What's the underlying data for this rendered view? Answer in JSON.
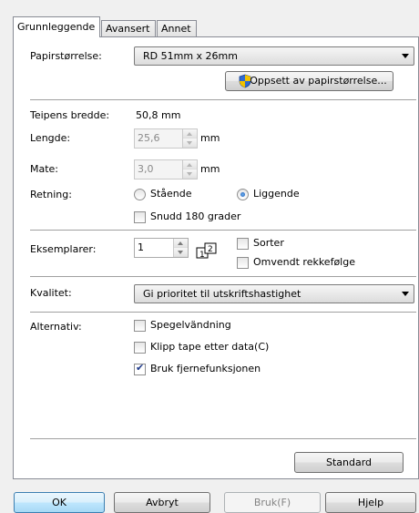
{
  "tabs": [
    "Grunnleggende",
    "Avansert",
    "Annet"
  ],
  "paper_size": {
    "label": "Papirstørrelse:",
    "value": "RD 51mm x 26mm",
    "setup_button": "Oppsett av papirstørrelse..."
  },
  "tape_width": {
    "label": "Teipens bredde:",
    "value": "50,8 mm"
  },
  "length": {
    "label": "Lengde:",
    "value": "25,6",
    "unit": "mm"
  },
  "feed": {
    "label": "Mate:",
    "value": "3,0",
    "unit": "mm"
  },
  "orientation": {
    "label": "Retning:",
    "options": [
      "Stående",
      "Liggende"
    ],
    "selected": "Liggende",
    "rotate_label": "Snudd 180 grader",
    "rotate_checked": false
  },
  "copies": {
    "label": "Eksemplarer:",
    "value": "1",
    "collate_label": "Sorter",
    "collate_checked": false,
    "reverse_label": "Omvendt rekkefølge",
    "reverse_checked": false
  },
  "quality": {
    "label": "Kvalitet:",
    "value": "Gi prioritet til utskriftshastighet"
  },
  "options": {
    "label": "Alternativ:",
    "items": [
      {
        "label": "Spegelvändning",
        "checked": false
      },
      {
        "label": "Klipp tape etter data(C)",
        "checked": false
      },
      {
        "label": "Bruk fjernefunksjonen",
        "checked": true
      }
    ]
  },
  "standard_button": "Standard",
  "dialog_buttons": {
    "ok": "OK",
    "cancel": "Avbryt",
    "apply": "Bruk(F)",
    "help": "Hjelp"
  },
  "colors": {
    "accent": "#3c7fb1",
    "panel": "#ffffff",
    "window": "#f0f0f0"
  },
  "icons": {
    "setup": "uac-shield-icon",
    "collate": "collate-pages-icon"
  }
}
